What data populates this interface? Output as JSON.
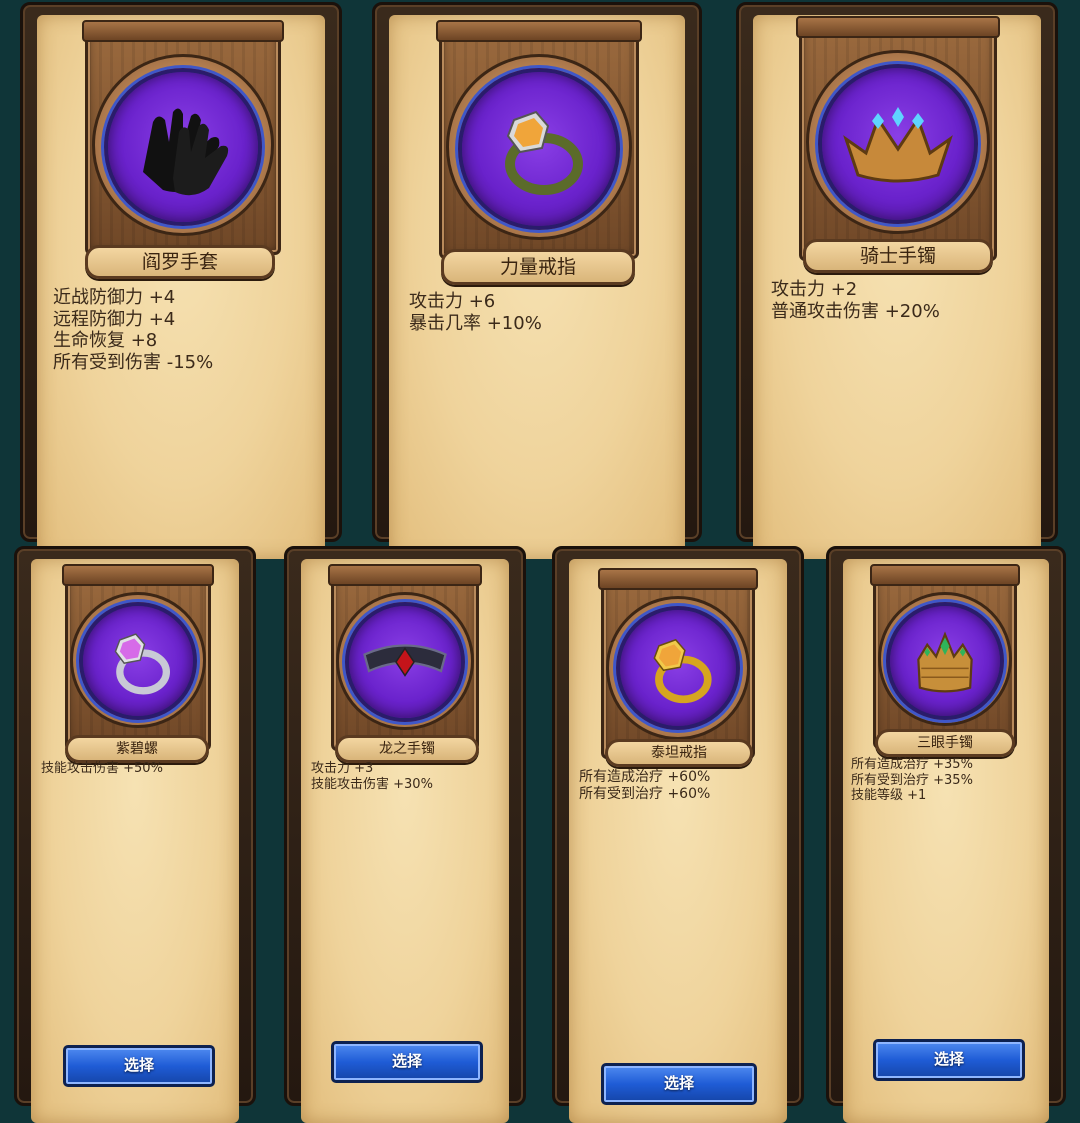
{
  "cards": [
    {
      "name": "阎罗手套",
      "icon": "black-gloves-icon",
      "stats": [
        "近战防御力 +4",
        "远程防御力 +4",
        "生命恢复 +8",
        "所有受到伤害 -15%"
      ]
    },
    {
      "name": "力量戒指",
      "icon": "amber-ring-icon",
      "stats": [
        "攻击力 +6",
        "暴击几率 +10%"
      ]
    },
    {
      "name": "骑士手镯",
      "icon": "jeweled-crown-icon",
      "stats": [
        "攻击力 +2",
        "普通攻击伤害 +20%"
      ]
    },
    {
      "name": "紫碧螺",
      "icon": "purple-gem-ring-icon",
      "stats": [
        "技能攻击伤害 +50%"
      ],
      "button": "选择"
    },
    {
      "name": "龙之手镯",
      "icon": "dragon-bracelet-icon",
      "stats": [
        "攻击力 +3",
        "技能攻击伤害 +30%"
      ],
      "button": "选择"
    },
    {
      "name": "泰坦戒指",
      "icon": "gold-ring-icon",
      "stats": [
        "所有造成治疗 +60%",
        "所有受到治疗 +60%"
      ],
      "button": "选择"
    },
    {
      "name": "三眼手镯",
      "icon": "emerald-crown-icon",
      "stats": [
        "所有造成治疗 +35%",
        "所有受到治疗 +35%",
        "技能等级 +1"
      ],
      "button": "选择"
    }
  ]
}
